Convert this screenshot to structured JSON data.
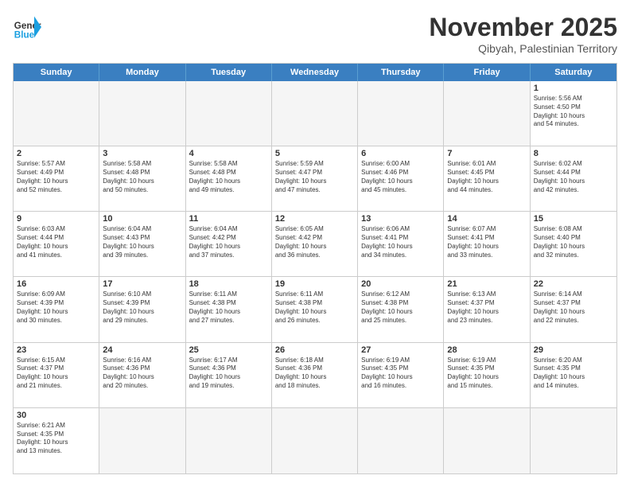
{
  "header": {
    "logo_general": "General",
    "logo_blue": "Blue",
    "month_title": "November 2025",
    "location": "Qibyah, Palestinian Territory"
  },
  "days": [
    "Sunday",
    "Monday",
    "Tuesday",
    "Wednesday",
    "Thursday",
    "Friday",
    "Saturday"
  ],
  "rows": [
    [
      {
        "day": "",
        "info": "",
        "empty": true
      },
      {
        "day": "",
        "info": "",
        "empty": true
      },
      {
        "day": "",
        "info": "",
        "empty": true
      },
      {
        "day": "",
        "info": "",
        "empty": true
      },
      {
        "day": "",
        "info": "",
        "empty": true
      },
      {
        "day": "",
        "info": "",
        "empty": true
      },
      {
        "day": "1",
        "info": "Sunrise: 5:56 AM\nSunset: 4:50 PM\nDaylight: 10 hours\nand 54 minutes."
      }
    ],
    [
      {
        "day": "2",
        "info": "Sunrise: 5:57 AM\nSunset: 4:49 PM\nDaylight: 10 hours\nand 52 minutes."
      },
      {
        "day": "3",
        "info": "Sunrise: 5:58 AM\nSunset: 4:48 PM\nDaylight: 10 hours\nand 50 minutes."
      },
      {
        "day": "4",
        "info": "Sunrise: 5:58 AM\nSunset: 4:48 PM\nDaylight: 10 hours\nand 49 minutes."
      },
      {
        "day": "5",
        "info": "Sunrise: 5:59 AM\nSunset: 4:47 PM\nDaylight: 10 hours\nand 47 minutes."
      },
      {
        "day": "6",
        "info": "Sunrise: 6:00 AM\nSunset: 4:46 PM\nDaylight: 10 hours\nand 45 minutes."
      },
      {
        "day": "7",
        "info": "Sunrise: 6:01 AM\nSunset: 4:45 PM\nDaylight: 10 hours\nand 44 minutes."
      },
      {
        "day": "8",
        "info": "Sunrise: 6:02 AM\nSunset: 4:44 PM\nDaylight: 10 hours\nand 42 minutes."
      }
    ],
    [
      {
        "day": "9",
        "info": "Sunrise: 6:03 AM\nSunset: 4:44 PM\nDaylight: 10 hours\nand 41 minutes."
      },
      {
        "day": "10",
        "info": "Sunrise: 6:04 AM\nSunset: 4:43 PM\nDaylight: 10 hours\nand 39 minutes."
      },
      {
        "day": "11",
        "info": "Sunrise: 6:04 AM\nSunset: 4:42 PM\nDaylight: 10 hours\nand 37 minutes."
      },
      {
        "day": "12",
        "info": "Sunrise: 6:05 AM\nSunset: 4:42 PM\nDaylight: 10 hours\nand 36 minutes."
      },
      {
        "day": "13",
        "info": "Sunrise: 6:06 AM\nSunset: 4:41 PM\nDaylight: 10 hours\nand 34 minutes."
      },
      {
        "day": "14",
        "info": "Sunrise: 6:07 AM\nSunset: 4:41 PM\nDaylight: 10 hours\nand 33 minutes."
      },
      {
        "day": "15",
        "info": "Sunrise: 6:08 AM\nSunset: 4:40 PM\nDaylight: 10 hours\nand 32 minutes."
      }
    ],
    [
      {
        "day": "16",
        "info": "Sunrise: 6:09 AM\nSunset: 4:39 PM\nDaylight: 10 hours\nand 30 minutes."
      },
      {
        "day": "17",
        "info": "Sunrise: 6:10 AM\nSunset: 4:39 PM\nDaylight: 10 hours\nand 29 minutes."
      },
      {
        "day": "18",
        "info": "Sunrise: 6:11 AM\nSunset: 4:38 PM\nDaylight: 10 hours\nand 27 minutes."
      },
      {
        "day": "19",
        "info": "Sunrise: 6:11 AM\nSunset: 4:38 PM\nDaylight: 10 hours\nand 26 minutes."
      },
      {
        "day": "20",
        "info": "Sunrise: 6:12 AM\nSunset: 4:38 PM\nDaylight: 10 hours\nand 25 minutes."
      },
      {
        "day": "21",
        "info": "Sunrise: 6:13 AM\nSunset: 4:37 PM\nDaylight: 10 hours\nand 23 minutes."
      },
      {
        "day": "22",
        "info": "Sunrise: 6:14 AM\nSunset: 4:37 PM\nDaylight: 10 hours\nand 22 minutes."
      }
    ],
    [
      {
        "day": "23",
        "info": "Sunrise: 6:15 AM\nSunset: 4:37 PM\nDaylight: 10 hours\nand 21 minutes."
      },
      {
        "day": "24",
        "info": "Sunrise: 6:16 AM\nSunset: 4:36 PM\nDaylight: 10 hours\nand 20 minutes."
      },
      {
        "day": "25",
        "info": "Sunrise: 6:17 AM\nSunset: 4:36 PM\nDaylight: 10 hours\nand 19 minutes."
      },
      {
        "day": "26",
        "info": "Sunrise: 6:18 AM\nSunset: 4:36 PM\nDaylight: 10 hours\nand 18 minutes."
      },
      {
        "day": "27",
        "info": "Sunrise: 6:19 AM\nSunset: 4:35 PM\nDaylight: 10 hours\nand 16 minutes."
      },
      {
        "day": "28",
        "info": "Sunrise: 6:19 AM\nSunset: 4:35 PM\nDaylight: 10 hours\nand 15 minutes."
      },
      {
        "day": "29",
        "info": "Sunrise: 6:20 AM\nSunset: 4:35 PM\nDaylight: 10 hours\nand 14 minutes."
      }
    ],
    [
      {
        "day": "30",
        "info": "Sunrise: 6:21 AM\nSunset: 4:35 PM\nDaylight: 10 hours\nand 13 minutes."
      },
      {
        "day": "",
        "info": "",
        "empty": true
      },
      {
        "day": "",
        "info": "",
        "empty": true
      },
      {
        "day": "",
        "info": "",
        "empty": true
      },
      {
        "day": "",
        "info": "",
        "empty": true
      },
      {
        "day": "",
        "info": "",
        "empty": true
      },
      {
        "day": "",
        "info": "",
        "empty": true
      }
    ]
  ]
}
